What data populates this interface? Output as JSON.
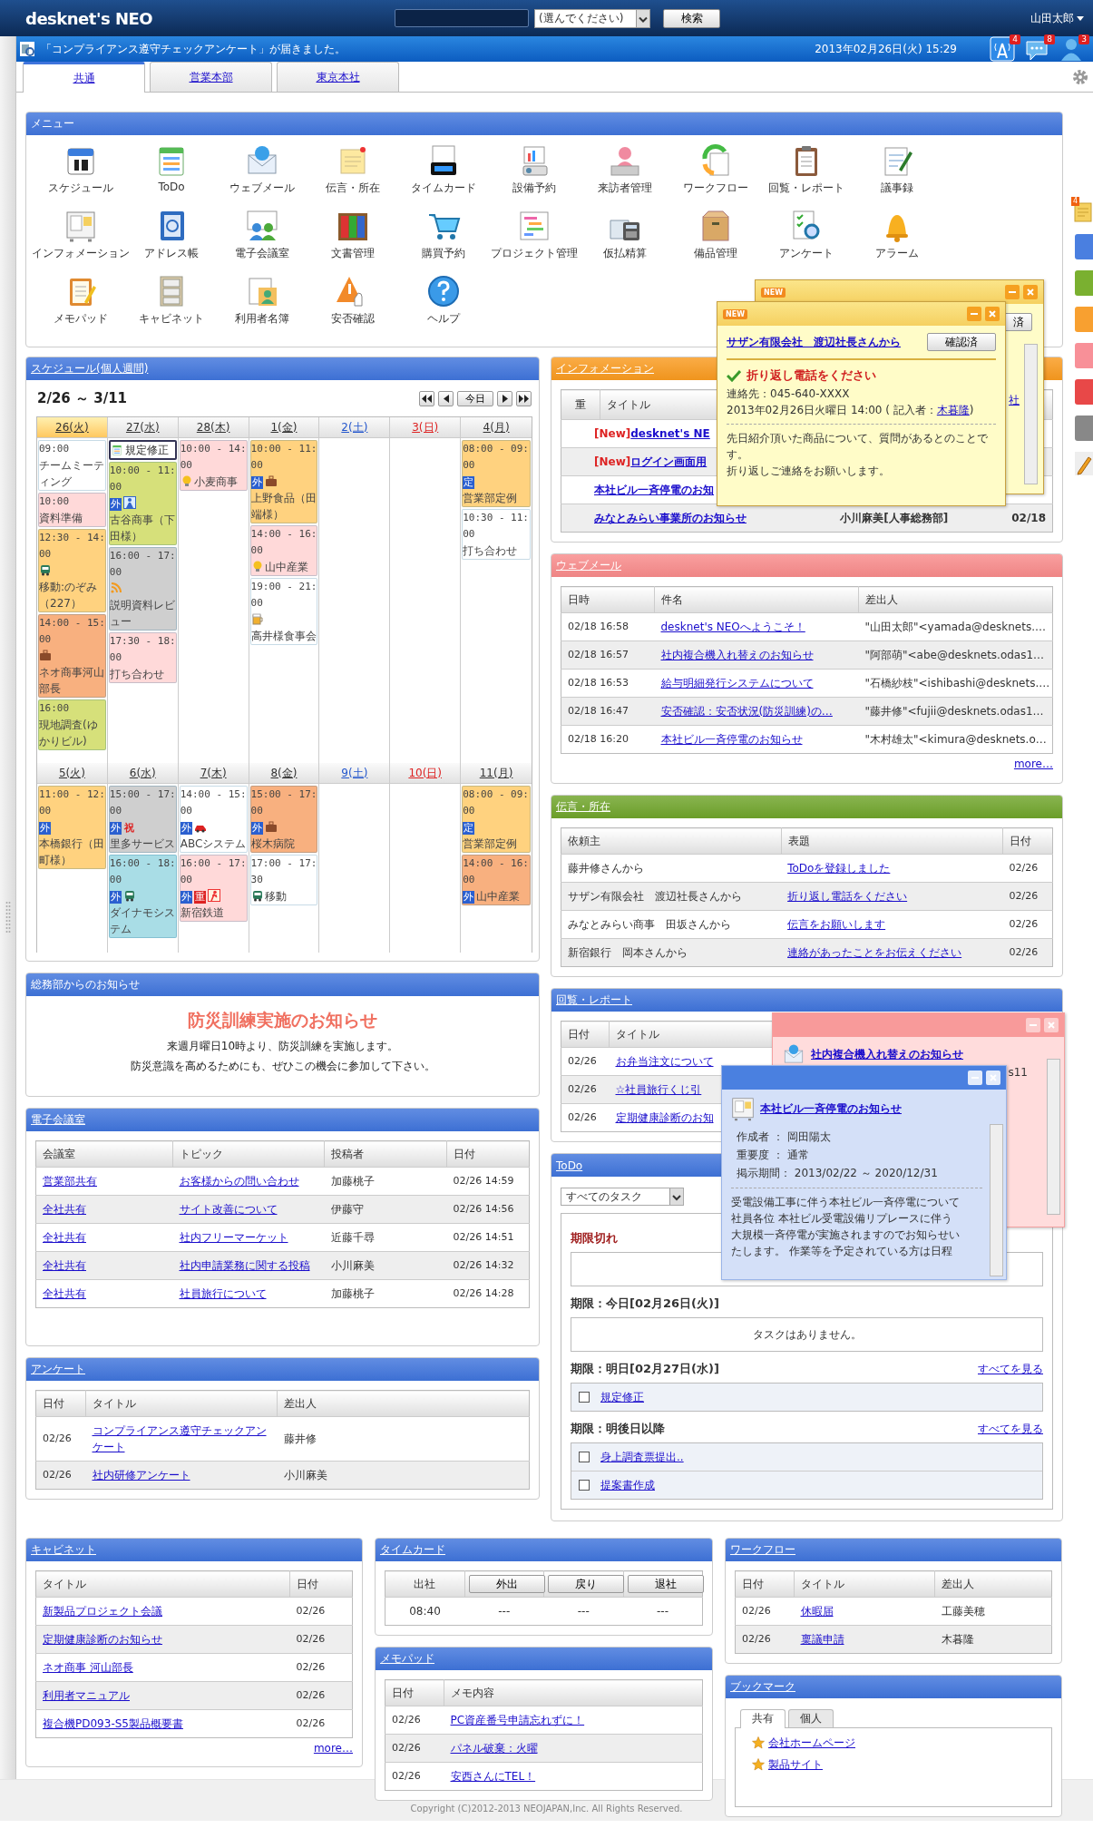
{
  "header": {
    "logo": "desknet's NEO",
    "search_select": "(選んでください)",
    "search_button": "検索",
    "user": "山田太郎"
  },
  "notice_bar": {
    "message": "「コンプライアンス遵守チェックアンケート」が届きました。",
    "datetime": "2013年02月26日(火) 15:29",
    "badges": [
      "4",
      "8",
      "3"
    ]
  },
  "tabs": [
    {
      "label": "共通",
      "selected": true
    },
    {
      "label": "営業本部",
      "selected": false
    },
    {
      "label": "東京本社",
      "selected": false
    }
  ],
  "menu": {
    "title": "メニュー",
    "color": "#3f74dc",
    "items": [
      "スケジュール",
      "ToDo",
      "ウェブメール",
      "伝言・所在",
      "タイムカード",
      "設備予約",
      "来訪者管理",
      "ワークフロー",
      "回覧・レポート",
      "議事録",
      "インフォメーション",
      "アドレス帳",
      "電子会議室",
      "文書管理",
      "購買予約",
      "プロジェクト管理",
      "仮払精算",
      "備品管理",
      "アンケート",
      "アラーム",
      "メモパッド",
      "キャビネット",
      "利用者名簿",
      "安否確認",
      "ヘルプ"
    ]
  },
  "schedule": {
    "title": "スケジュール(個人週間)",
    "color": "#3f74dc",
    "range": "2/26 ～ 3/11",
    "today_button": "今日",
    "weeks": [
      {
        "days": [
          {
            "label": "26(火)",
            "kind": "weekday",
            "selected": true,
            "events": [
              {
                "kind": "plain",
                "time": "09:00",
                "title": "チームミーティング",
                "color": "#ffffff"
              },
              {
                "kind": "plain",
                "time": "10:00",
                "title": "資料準備",
                "color": "#ffd9d9"
              },
              {
                "kind": "travel",
                "time": "12:30 - 14:00",
                "title": "移動:のぞみ（227）",
                "color": "#ffd27f"
              },
              {
                "kind": "visit",
                "time": "14:00 - 15:00",
                "title": "ネオ商事河山部長",
                "color": "#f8b07f"
              },
              {
                "kind": "plain",
                "time": "16:00",
                "title": "現地調査(ゆかりビル)",
                "color": "#d6e07a"
              }
            ]
          },
          {
            "label": "27(水)",
            "kind": "weekday",
            "selected": false,
            "events": [
              {
                "kind": "todo",
                "title": "規定修正"
              },
              {
                "kind": "person",
                "time": "10:00 - 11:00",
                "tags": [
                  {
                    "text": "外",
                    "kind": "badge"
                  }
                ],
                "title": "古谷商事（下田様）",
                "color": "#d6e07a"
              },
              {
                "kind": "feed",
                "time": "16:00 - 17:00",
                "title": "説明資料レビュー",
                "color": "#cfcfcf"
              },
              {
                "kind": "plain",
                "time": "17:30 - 18:00",
                "title": "打ち合わせ",
                "color": "#ffd9d9"
              }
            ]
          },
          {
            "label": "28(木)",
            "kind": "weekday",
            "selected": false,
            "events": [
              {
                "kind": "idea",
                "time": "10:00 - 14:00",
                "title": "小麦商事",
                "color": "#ffd9d9"
              }
            ]
          },
          {
            "label": "1(金)",
            "kind": "weekday",
            "selected": false,
            "events": [
              {
                "kind": "visit",
                "time": "10:00 - 11:00",
                "tags": [
                  {
                    "text": "外",
                    "kind": "badge"
                  }
                ],
                "title": "上野食品（田端様）",
                "color": "#ffd27f"
              },
              {
                "kind": "idea",
                "time": "14:00 - 16:00",
                "title": "山中産業",
                "color": "#ffd9d9"
              },
              {
                "kind": "meal",
                "time": "19:00 - 21:00",
                "title": "高井様食事会",
                "color": "#ffffff"
              }
            ]
          },
          {
            "label": "2(土)",
            "kind": "saturday",
            "selected": false
          },
          {
            "label": "3(日)",
            "kind": "sunday",
            "selected": false
          },
          {
            "label": "4(月)",
            "kind": "weekday",
            "selected": false,
            "events": [
              {
                "kind": "plain",
                "time": "08:00 - 09:00",
                "tags": [
                  {
                    "text": "定",
                    "kind": "badge"
                  }
                ],
                "title": "営業部定例",
                "color": "#ffd27f"
              },
              {
                "kind": "plain",
                "time": "10:30 - 11:00",
                "title": "打ち合わせ",
                "color": "#ffffff"
              }
            ]
          }
        ]
      },
      {
        "days": [
          {
            "label": "5(火)",
            "kind": "weekday",
            "selected": false,
            "events": [
              {
                "kind": "plain",
                "time": "11:00 - 12:00",
                "tags": [
                  {
                    "text": "外",
                    "kind": "badge"
                  }
                ],
                "title": "本橋銀行（田町様）",
                "color": "#ffd27f"
              }
            ]
          },
          {
            "label": "6(水)",
            "kind": "weekday",
            "selected": false,
            "events": [
              {
                "kind": "plain",
                "time": "15:00 - 17:00",
                "tags": [
                  {
                    "text": "外",
                    "kind": "badge"
                  },
                  {
                    "text": "祝",
                    "kind": "mark"
                  }
                ],
                "title": "里多サービス",
                "color": "#cfcfcf"
              },
              {
                "kind": "travel",
                "time": "16:00 - 18:00",
                "tags": [
                  {
                    "text": "外",
                    "kind": "badge"
                  }
                ],
                "title": "ダイナモシステム",
                "color": "#a9dde6"
              }
            ]
          },
          {
            "label": "7(木)",
            "kind": "weekday",
            "selected": false,
            "events": [
              {
                "kind": "drive",
                "time": "14:00 - 15:00",
                "tags": [
                  {
                    "text": "外",
                    "kind": "badge"
                  }
                ],
                "title": "ABCシステム",
                "color": "#ffffff"
              },
              {
                "kind": "emergency",
                "time": "16:00 - 17:00",
                "tags": [
                  {
                    "text": "外",
                    "kind": "badge"
                  },
                  {
                    "text": "重",
                    "kind": "alert"
                  }
                ],
                "title": "新宿鉄道",
                "color": "#ffd9d9"
              }
            ]
          },
          {
            "label": "8(金)",
            "kind": "weekday",
            "selected": false,
            "events": [
              {
                "kind": "visit",
                "time": "15:00 - 17:00",
                "tags": [
                  {
                    "text": "外",
                    "kind": "badge"
                  }
                ],
                "title": "桜木病院",
                "color": "#f8b07f"
              },
              {
                "kind": "travel",
                "time": "17:00 - 17:30",
                "title": "移動",
                "color": "#ffffff"
              }
            ]
          },
          {
            "label": "9(土)",
            "kind": "saturday",
            "selected": false
          },
          {
            "label": "10(日)",
            "kind": "sunday",
            "selected": false
          },
          {
            "label": "11(月)",
            "kind": "weekday",
            "selected": false,
            "events": [
              {
                "kind": "plain",
                "time": "08:00 - 09:00",
                "tags": [
                  {
                    "text": "定",
                    "kind": "badge"
                  }
                ],
                "title": "営業部定例",
                "color": "#ffd27f"
              },
              {
                "kind": "plain",
                "time": "14:00 - 16:00",
                "tags": [
                  {
                    "text": "外",
                    "kind": "badge"
                  }
                ],
                "title": "山中産業",
                "color": "#f8b07f"
              }
            ]
          }
        ]
      }
    ]
  },
  "general_affairs": {
    "title": "総務部からのお知らせ",
    "color": "#3f74dc",
    "headline": "防災訓練実施のお知らせ",
    "lines": [
      "来週月曜日10時より、防災訓練を実施します。",
      "防災意識を高めるためにも、ぜひこの機会に参加して下さい。"
    ]
  },
  "forum": {
    "title": "電子会議室",
    "color": "#3f74dc",
    "columns": [
      {
        "label": "会議室",
        "kind": "link"
      },
      {
        "label": "トピック",
        "kind": "link"
      },
      {
        "label": "投稿者",
        "kind": "text"
      },
      {
        "label": "日付",
        "kind": "date"
      }
    ],
    "rows": [
      [
        "営業部共有",
        "お客様からの問い合わせ",
        "加藤桃子",
        "02/26 14:59"
      ],
      [
        "全社共有",
        "サイト改善について",
        "伊藤守",
        "02/26 14:56"
      ],
      [
        "全社共有",
        "社内フリーマーケット",
        "近藤千尋",
        "02/26 14:51"
      ],
      [
        "全社共有",
        "社内申請業務に関する投稿",
        "小川麻美",
        "02/26 14:32"
      ],
      [
        "全社共有",
        "社員旅行について",
        "加藤桃子",
        "02/26 14:28"
      ]
    ]
  },
  "survey": {
    "title": "アンケート",
    "color": "#3f74dc",
    "columns": [
      {
        "label": "日付",
        "kind": "date"
      },
      {
        "label": "タイトル",
        "kind": "link"
      },
      {
        "label": "差出人",
        "kind": "text"
      }
    ],
    "rows": [
      [
        "02/26",
        "コンプライアンス遵守チェックアンケート",
        "藤井修"
      ],
      [
        "02/26",
        "社内研修アンケート",
        "小川麻美"
      ]
    ]
  },
  "information": {
    "title": "インフォメーション",
    "color": "#f99a1e",
    "columns": [
      "重",
      "タイトル"
    ],
    "rows": [
      {
        "new_label": "[New]",
        "title": "desknet's NE"
      },
      {
        "new_label": "[New]",
        "title": "ログイン画面用"
      },
      {
        "title": "本社ビル一斉停電のお知"
      },
      {
        "title": "みなとみらい事業所のお知らせ",
        "sender": "小川麻美[人事総務部]",
        "date": "02/18"
      }
    ]
  },
  "webmail": {
    "title": "ウェブメール",
    "color": "#f88a8a",
    "columns": [
      {
        "label": "日時",
        "kind": "date"
      },
      {
        "label": "件名",
        "kind": "link"
      },
      {
        "label": "差出人",
        "kind": "text"
      }
    ],
    "rows": [
      [
        "02/18 16:58",
        "desknet's NEOへようこそ！",
        "\"山田太郎\"<yamada@desknets.…"
      ],
      [
        "02/18 16:57",
        "社内複合機入れ替えのお知らせ",
        "\"阿部萌\"<abe@desknets.odas1…"
      ],
      [
        "02/18 16:53",
        "給与明細発行システムについて",
        "\"石橋紗枝\"<ishibashi@desknets.…"
      ],
      [
        "02/18 16:47",
        "安否確認：安否状況(防災訓練)の…",
        "\"藤井修\"<fujii@desknets.odas1…"
      ],
      [
        "02/18 16:20",
        "本社ビル一斉停電のお知らせ",
        "\"木村雄太\"<kimura@desknets.o…"
      ]
    ],
    "more": "more…"
  },
  "messages": {
    "title": "伝言・所在",
    "color": "#6fa42a",
    "columns": [
      {
        "label": "依頼主",
        "kind": "text"
      },
      {
        "label": "表題",
        "kind": "link"
      },
      {
        "label": "日付",
        "kind": "date"
      }
    ],
    "rows": [
      [
        "藤井修さんから",
        "ToDoを登録しました",
        "02/26"
      ],
      [
        "サザン有限会社　渡辺社長さんから",
        "折り返し電話をください",
        "02/26"
      ],
      [
        "みなとみらい商事　田坂さんから",
        "伝言をお願いします",
        "02/26"
      ],
      [
        "新宿銀行　岡本さんから",
        "連絡があったことをお伝えください",
        "02/26"
      ]
    ]
  },
  "circulation": {
    "title": "回覧・レポート",
    "color": "#3f74dc",
    "columns": [
      {
        "label": "日付",
        "kind": "date"
      },
      {
        "label": "タイトル",
        "kind": "link"
      }
    ],
    "rows": [
      [
        "02/26",
        "お弁当注文について"
      ],
      [
        "02/26",
        "☆社員旅行くじ引"
      ],
      [
        "02/26",
        "定期健康診断のお知"
      ]
    ]
  },
  "todo": {
    "title": "ToDo",
    "color": "#3f74dc",
    "filter": "すべてのタスク",
    "sections": [
      {
        "title": "期限切れ",
        "kind": "overdue"
      },
      {
        "title": "期限：今日[02月26日(火)]",
        "kind": "empty",
        "message": "タスクはありません。"
      },
      {
        "title": "期限：明日[02月27日(水)]",
        "kind": "tasks",
        "see_all": "すべてを見る",
        "items": [
          {
            "label": "規定修正",
            "checked": false
          }
        ]
      },
      {
        "title": "期限：明後日以降",
        "kind": "tasks",
        "see_all": "すべてを見る",
        "items": [
          {
            "label": "身上調査票提出..",
            "checked": false
          },
          {
            "label": "提案書作成",
            "checked": false
          }
        ]
      }
    ]
  },
  "cabinet": {
    "title": "キャビネット",
    "color": "#3f74dc",
    "columns": [
      {
        "label": "タイトル",
        "kind": "link"
      },
      {
        "label": "日付",
        "kind": "date"
      }
    ],
    "rows": [
      [
        "新製品プロジェクト会議",
        "02/26"
      ],
      [
        "定期健康診断のお知らせ",
        "02/26"
      ],
      [
        "ネオ商事 河山部長",
        "02/26"
      ],
      [
        "利用者マニュアル",
        "02/26"
      ],
      [
        "複合機PD093-S5製品概要書",
        "02/26"
      ]
    ],
    "more": "more…"
  },
  "timecard": {
    "title": "タイムカード",
    "color": "#3f74dc",
    "clock_in": "出社",
    "buttons": [
      "外出",
      "戻り",
      "退社"
    ],
    "values": [
      "08:40",
      "---",
      "---",
      "---"
    ]
  },
  "memopad": {
    "title": "メモパッド",
    "color": "#3f74dc",
    "columns": [
      {
        "label": "日付",
        "kind": "date"
      },
      {
        "label": "メモ内容",
        "kind": "link"
      }
    ],
    "rows": [
      [
        "02/26",
        "PC資産番号申請忘れずに！"
      ],
      [
        "02/26",
        "パネル破棄：火曜"
      ],
      [
        "02/26",
        "安西さんにTEL！"
      ]
    ]
  },
  "workflow": {
    "title": "ワークフロー",
    "color": "#3f74dc",
    "columns": [
      {
        "label": "日付",
        "kind": "date"
      },
      {
        "label": "タイトル",
        "kind": "link"
      },
      {
        "label": "差出人",
        "kind": "text"
      }
    ],
    "rows": [
      [
        "02/26",
        "休暇届",
        "工藤美穂"
      ],
      [
        "02/26",
        "稟議申請",
        "木暮隆"
      ]
    ]
  },
  "bookmarks": {
    "title": "ブックマーク",
    "color": "#3f74dc",
    "tabs": [
      {
        "label": "共有",
        "selected": true
      },
      {
        "label": "個人",
        "selected": false
      }
    ],
    "items": [
      "会社ホームページ",
      "製品サイト"
    ]
  },
  "message_popup_back": {
    "badge": "NEW",
    "button": "済",
    "link": "社"
  },
  "message_popup": {
    "badge": "NEW",
    "from": "サザン有限会社　渡辺社長さんから",
    "button": "確認済",
    "subject": "折り返し電話をください",
    "contact": "連絡先：045-640-XXXX",
    "written": "2013年02月26日火曜日 14:00 ( 記入者：",
    "writer": "木暮隆",
    "written_end": ")",
    "body": [
      "先日紹介頂いた商品について、質問があるとのことです。",
      "折り返しご連絡をお願いします。"
    ]
  },
  "mail_popup": {
    "subject": "社内複合機入れ替えのお知らせ",
    "fragment": "s11"
  },
  "info_popup": {
    "title": "本社ビル一斉停電のお知らせ",
    "fields": [
      "作成者 ： 岡田陽太",
      "重要度 ： 通常",
      "掲示期間： 2013/02/22 ～ 2020/12/31"
    ],
    "body": [
      "受電設備工事に伴う本社ビル一斉停電について",
      "社員各位 本社ビル受電設備リプレースに伴う",
      "大規模一斉停電が実施されますのでお知らせい",
      "たします。 作業等を予定されている方は日程"
    ]
  },
  "side_notes": {
    "badge": "4",
    "tabs": [
      {
        "color": "#4a7fe0"
      },
      {
        "color": "#7ab030"
      },
      {
        "color": "#f8a030"
      },
      {
        "color": "#f89098"
      },
      {
        "color": "#e84848"
      },
      {
        "color": "#888888"
      }
    ]
  },
  "footer": {
    "copyright": "Copyright (C)2012-2013 NEOJAPAN,Inc. All Rights Reserved."
  }
}
